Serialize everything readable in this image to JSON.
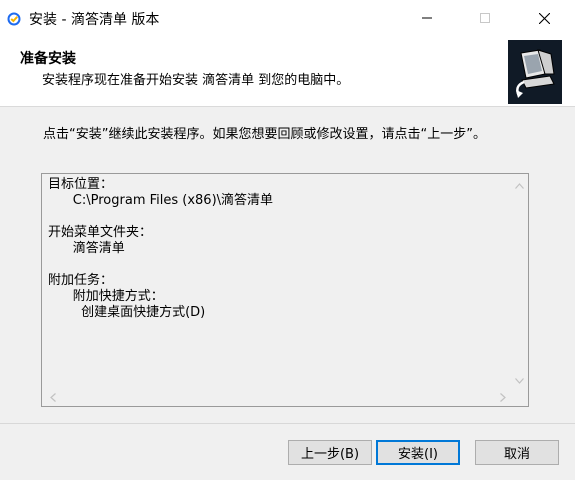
{
  "window": {
    "title": "安装 - 滴答清单 版本"
  },
  "header": {
    "title": "准备安装",
    "subtitle": "安装程序现在准备开始安装 滴答清单 到您的电脑中。"
  },
  "intro_text": "点击“安装”继续此安装程序。如果您想要回顾或修改设置，请点击“上一步”。",
  "memo": {
    "destination_label": "目标位置：",
    "destination_value": "C:\\Program Files (x86)\\滴答清单",
    "startmenu_label": "开始菜单文件夹：",
    "startmenu_value": "滴答清单",
    "tasks_label": "附加任务：",
    "tasks_group": "附加快捷方式：",
    "tasks_item": "创建桌面快捷方式(D)"
  },
  "buttons": {
    "back": "上一步(B)",
    "install": "安装(I)",
    "cancel": "取消"
  },
  "colors": {
    "default_button_border": "#0078d7",
    "dialog_bg": "#f0f0f0",
    "app_icon_blue": "#1e6bf0",
    "app_icon_yellow": "#f5b400"
  }
}
